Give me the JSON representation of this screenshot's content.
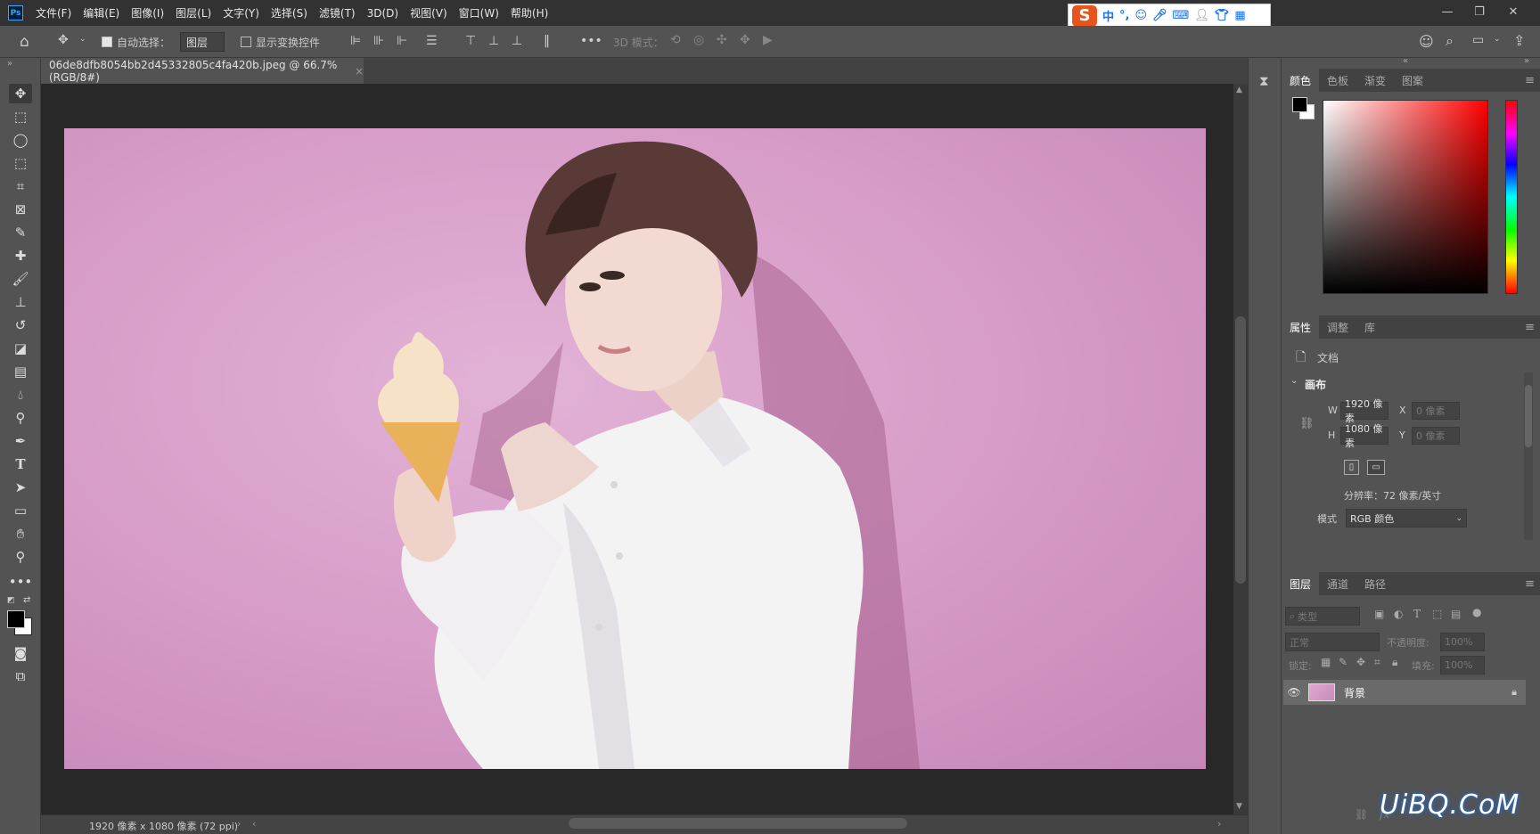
{
  "menubar": {
    "app_icon": "Ps",
    "items": [
      "文件(F)",
      "编辑(E)",
      "图像(I)",
      "图层(L)",
      "文字(Y)",
      "选择(S)",
      "滤镜(T)",
      "3D(D)",
      "视图(V)",
      "窗口(W)",
      "帮助(H)"
    ]
  },
  "ime": {
    "logo": "S",
    "mode": "中",
    "punct": "°,"
  },
  "window_controls": {
    "minimize": "—",
    "restore": "❐",
    "close": "✕"
  },
  "options": {
    "auto_select_label": "自动选择：",
    "auto_select_checked": true,
    "auto_select_target": "图层",
    "show_transform_label": "显示变换控件",
    "more": "•••",
    "mode_3d_label": "3D 模式："
  },
  "document": {
    "tab_title": "06de8dfb8054bb2d45332805c4fa420b.jpeg @ 66.7%(RGB/8#)",
    "tab_close": "×",
    "status": "1920 像素 x 1080 像素 (72 ppi)"
  },
  "color_panel": {
    "tabs": [
      "颜色",
      "色板",
      "渐变",
      "图案"
    ],
    "foreground": "#000000",
    "background": "#ffffff"
  },
  "properties_panel": {
    "tabs": [
      "属性",
      "调整",
      "库"
    ],
    "doc_label": "文档",
    "section": "画布",
    "w_label": "W",
    "w_value": "1920 像素",
    "h_label": "H",
    "h_value": "1080 像素",
    "x_label": "X",
    "x_value": "0 像素",
    "y_label": "Y",
    "y_value": "0 像素",
    "resolution": "分辨率：72 像素/英寸",
    "mode_label": "模式",
    "mode_value": "RGB 颜色"
  },
  "layers_panel": {
    "tabs": [
      "图层",
      "通道",
      "路径"
    ],
    "filter_placeholder": "类型",
    "blend_mode": "正常",
    "opacity_label": "不透明度:",
    "opacity_value": "100%",
    "lock_label": "锁定:",
    "fill_label": "填充:",
    "fill_value": "100%",
    "layer_name": "背景"
  },
  "watermark": "UiBQ.CoM"
}
